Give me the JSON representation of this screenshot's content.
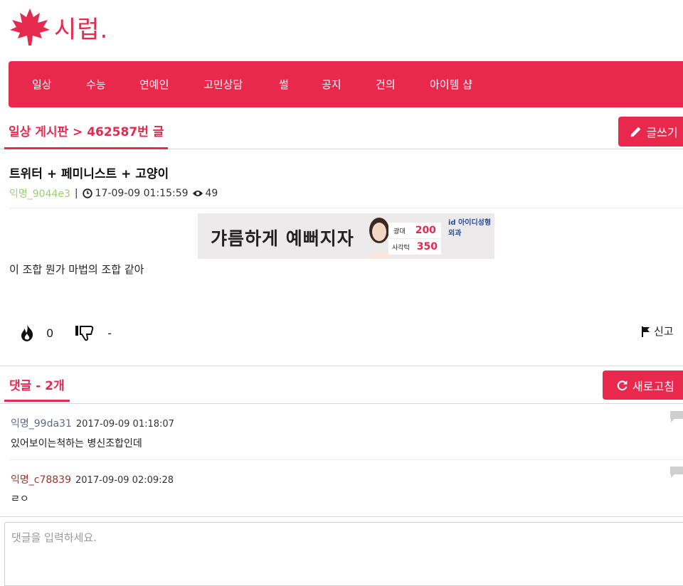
{
  "brand": {
    "logo_text": "시럽.",
    "color": "#e5294f"
  },
  "nav": {
    "items": [
      {
        "label": "일상"
      },
      {
        "label": "수능"
      },
      {
        "label": "연예인"
      },
      {
        "label": "고민상담"
      },
      {
        "label": "썰"
      },
      {
        "label": "공지"
      },
      {
        "label": "건의"
      },
      {
        "label": "아이템 샵"
      }
    ]
  },
  "board": {
    "breadcrumb": "일상 게시판 > 462587번 글",
    "write_button": "글쓰기"
  },
  "post": {
    "title": "트위터 + 페미니스트 + 고양이",
    "author": "익명_9044e3",
    "datetime": "17-09-09 01:15:59",
    "views": "49",
    "body": "이 조합 뭔가 마법의 조합 같아",
    "likes": "0",
    "dislikes": "-",
    "report_label": "신고"
  },
  "ad": {
    "headline": "갸름하게 예뻐지자",
    "item1_label": "광대",
    "item1_value": "200",
    "item2_label": "사각턱",
    "item2_value": "350",
    "brand": "id 아이디성형외과"
  },
  "comments": {
    "header": "댓글 - 2개",
    "refresh_button": "새로고침",
    "items": [
      {
        "author": "익명_99da31",
        "author_color": "#5a6b8c",
        "datetime": "2017-09-09 01:18:07",
        "body": "있어보이는척하는 병신조합인데"
      },
      {
        "author": "익명_c78839",
        "author_color": "#a0342a",
        "datetime": "2017-09-09 02:09:28",
        "body": "ㄹㅇ"
      }
    ],
    "input_placeholder": "댓글을 입력하세요."
  }
}
